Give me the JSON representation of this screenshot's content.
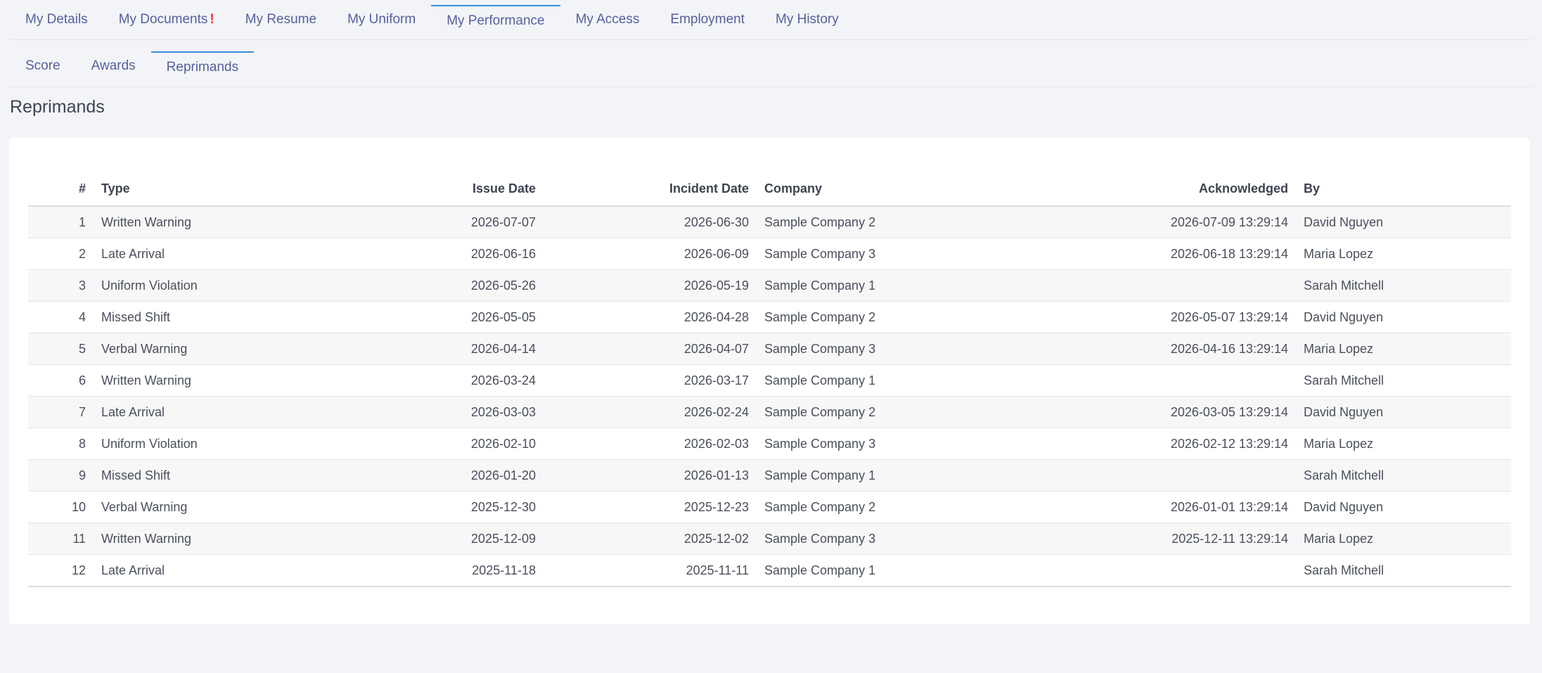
{
  "main_tabs": [
    {
      "label": "My Details"
    },
    {
      "label": "My Documents",
      "alert": "!"
    },
    {
      "label": "My Resume"
    },
    {
      "label": "My Uniform"
    },
    {
      "label": "My Performance"
    },
    {
      "label": "My Access"
    },
    {
      "label": "Employment"
    },
    {
      "label": "My History"
    }
  ],
  "sub_tabs": [
    {
      "label": "Score"
    },
    {
      "label": "Awards"
    },
    {
      "label": "Reprimands"
    }
  ],
  "page_title": "Reprimands",
  "table": {
    "headers": {
      "num": "#",
      "type": "Type",
      "issue_date": "Issue Date",
      "incident_date": "Incident Date",
      "company": "Company",
      "acknowledged": "Acknowledged",
      "by": "By"
    },
    "rows": [
      {
        "num": "1",
        "type": "Written Warning",
        "issue_date": "2026-07-07",
        "incident_date": "2026-06-30",
        "company": "Sample Company 2",
        "acknowledged": "2026-07-09 13:29:14",
        "by": "David Nguyen"
      },
      {
        "num": "2",
        "type": "Late Arrival",
        "issue_date": "2026-06-16",
        "incident_date": "2026-06-09",
        "company": "Sample Company 3",
        "acknowledged": "2026-06-18 13:29:14",
        "by": "Maria Lopez"
      },
      {
        "num": "3",
        "type": "Uniform Violation",
        "issue_date": "2026-05-26",
        "incident_date": "2026-05-19",
        "company": "Sample Company 1",
        "acknowledged": "",
        "by": "Sarah Mitchell"
      },
      {
        "num": "4",
        "type": "Missed Shift",
        "issue_date": "2026-05-05",
        "incident_date": "2026-04-28",
        "company": "Sample Company 2",
        "acknowledged": "2026-05-07 13:29:14",
        "by": "David Nguyen"
      },
      {
        "num": "5",
        "type": "Verbal Warning",
        "issue_date": "2026-04-14",
        "incident_date": "2026-04-07",
        "company": "Sample Company 3",
        "acknowledged": "2026-04-16 13:29:14",
        "by": "Maria Lopez"
      },
      {
        "num": "6",
        "type": "Written Warning",
        "issue_date": "2026-03-24",
        "incident_date": "2026-03-17",
        "company": "Sample Company 1",
        "acknowledged": "",
        "by": "Sarah Mitchell"
      },
      {
        "num": "7",
        "type": "Late Arrival",
        "issue_date": "2026-03-03",
        "incident_date": "2026-02-24",
        "company": "Sample Company 2",
        "acknowledged": "2026-03-05 13:29:14",
        "by": "David Nguyen"
      },
      {
        "num": "8",
        "type": "Uniform Violation",
        "issue_date": "2026-02-10",
        "incident_date": "2026-02-03",
        "company": "Sample Company 3",
        "acknowledged": "2026-02-12 13:29:14",
        "by": "Maria Lopez"
      },
      {
        "num": "9",
        "type": "Missed Shift",
        "issue_date": "2026-01-20",
        "incident_date": "2026-01-13",
        "company": "Sample Company 1",
        "acknowledged": "",
        "by": "Sarah Mitchell"
      },
      {
        "num": "10",
        "type": "Verbal Warning",
        "issue_date": "2025-12-30",
        "incident_date": "2025-12-23",
        "company": "Sample Company 2",
        "acknowledged": "2026-01-01 13:29:14",
        "by": "David Nguyen"
      },
      {
        "num": "11",
        "type": "Written Warning",
        "issue_date": "2025-12-09",
        "incident_date": "2025-12-02",
        "company": "Sample Company 3",
        "acknowledged": "2025-12-11 13:29:14",
        "by": "Maria Lopez"
      },
      {
        "num": "12",
        "type": "Late Arrival",
        "issue_date": "2025-11-18",
        "incident_date": "2025-11-11",
        "company": "Sample Company 1",
        "acknowledged": "",
        "by": "Sarah Mitchell"
      }
    ]
  }
}
